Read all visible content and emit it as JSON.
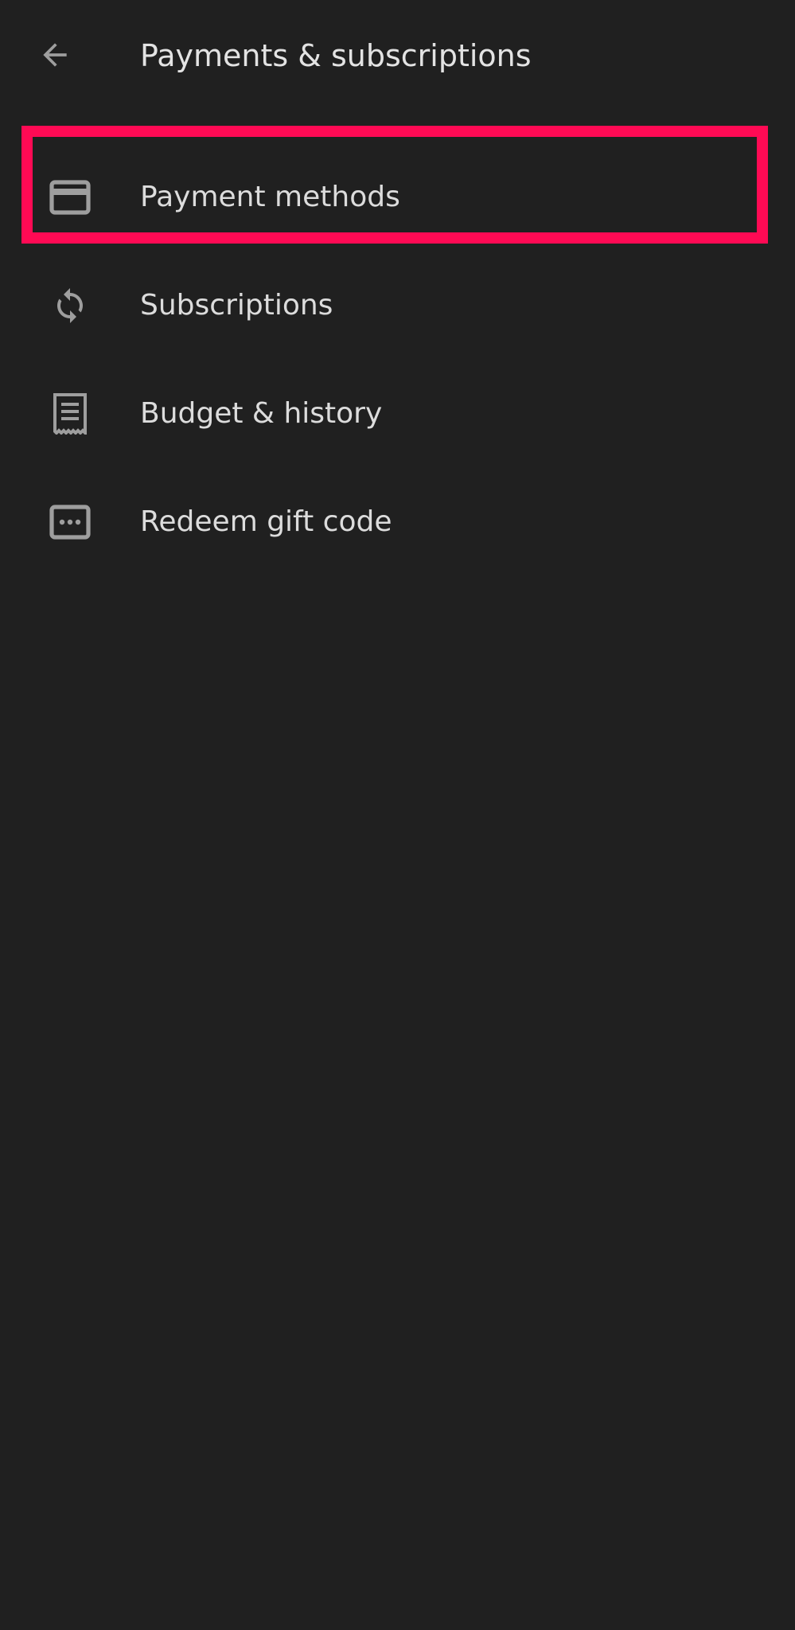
{
  "header": {
    "title": "Payments & subscriptions",
    "back_icon": "arrow-back-icon"
  },
  "menu": {
    "items": [
      {
        "label": "Payment methods",
        "icon": "credit-card-icon"
      },
      {
        "label": "Subscriptions",
        "icon": "refresh-icon"
      },
      {
        "label": "Budget & history",
        "icon": "receipt-icon"
      },
      {
        "label": "Redeem gift code",
        "icon": "gift-code-icon"
      }
    ]
  },
  "highlight": {
    "target": "Payment methods",
    "color": "#ff0a54"
  },
  "colors": {
    "background": "#202020",
    "text": "#e3e3e3",
    "icon": "#9e9e9e"
  }
}
